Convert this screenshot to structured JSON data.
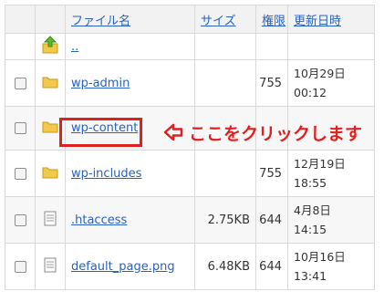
{
  "headers": {
    "name": "ファイル名",
    "size": "サイズ",
    "perm": "権限",
    "date": "更新日時"
  },
  "parent": {
    "name": ".."
  },
  "rows": [
    {
      "name": "wp-admin",
      "type": "folder",
      "size": "",
      "perm": "755",
      "date1": "10月29日",
      "date2": "00:12"
    },
    {
      "name": "wp-content",
      "type": "folder",
      "size": "",
      "perm": "",
      "date1": "",
      "date2": ""
    },
    {
      "name": "wp-includes",
      "type": "folder",
      "size": "",
      "perm": "755",
      "date1": "12月19日",
      "date2": "18:55"
    },
    {
      "name": ".htaccess",
      "type": "file",
      "size": "2.75KB",
      "perm": "644",
      "date1": "4月8日",
      "date2": "14:15"
    },
    {
      "name": "default_page.png",
      "type": "file",
      "size": "6.48KB",
      "perm": "644",
      "date1": "10月16日",
      "date2": "13:41"
    }
  ],
  "annotation": {
    "text": "ここをクリックします",
    "color": "#e02020"
  },
  "colors": {
    "link": "#2a62bd",
    "folder": "#f3c94a",
    "arrow": "#5cb82e",
    "highlight": "#e02020"
  }
}
